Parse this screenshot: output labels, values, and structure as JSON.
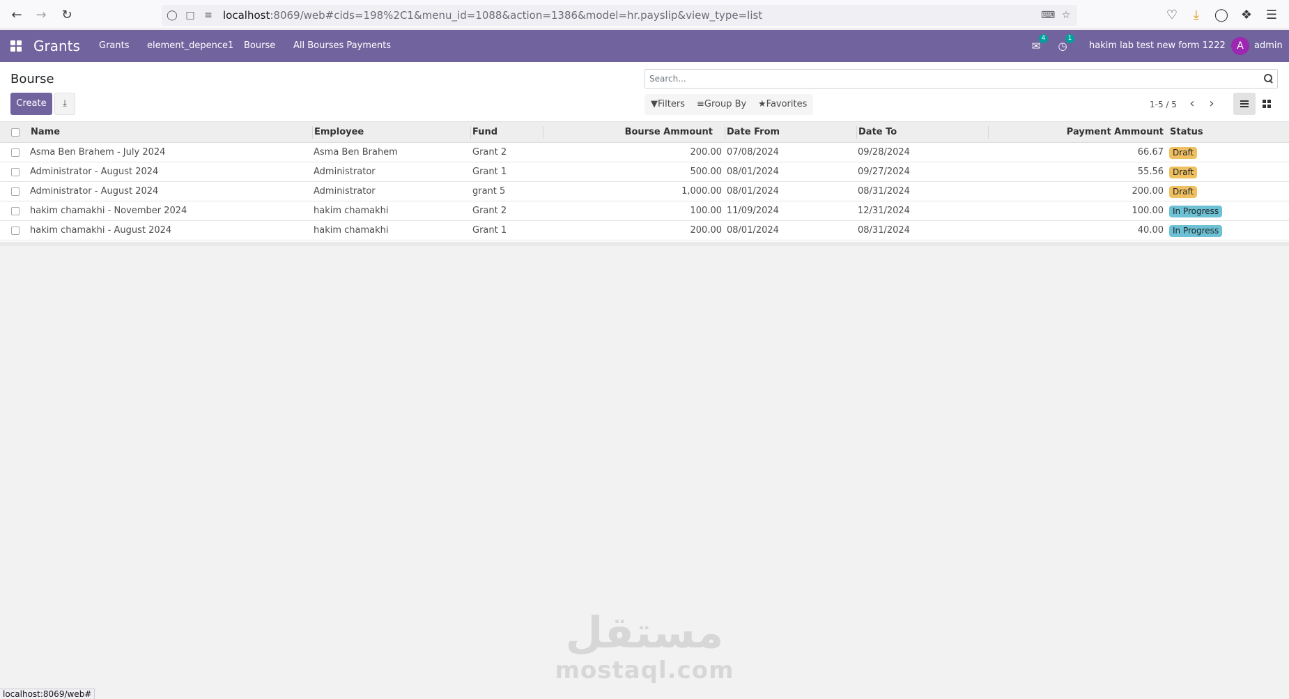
{
  "browser": {
    "url_host": "localhost",
    "url_rest": ":8069/web#cids=198%2C1&menu_id=1088&action=1386&model=hr.payslip&view_type=list",
    "status_url": "localhost:8069/web#"
  },
  "navbar": {
    "app_name": "Grants",
    "menu": [
      "Grants",
      "element_depence1",
      "Bourse",
      "All Bourses Payments"
    ],
    "messages_count": "4",
    "activities_count": "1",
    "company": "hakim lab test new form 1222",
    "avatar_letter": "A",
    "user": "admin"
  },
  "control_panel": {
    "title": "Bourse",
    "create_label": "Create",
    "search_placeholder": "Search...",
    "filters_label": "Filters",
    "group_by_label": "Group By",
    "favorites_label": "Favorites",
    "pager": "1-5 / 5"
  },
  "table": {
    "columns": {
      "name": "Name",
      "employee": "Employee",
      "fund": "Fund",
      "bourse_amount": "Bourse Ammount",
      "date_from": "Date From",
      "date_to": "Date To",
      "payment_amount": "Payment Ammount",
      "status": "Status"
    },
    "rows": [
      {
        "name": "Asma Ben Brahem - July 2024",
        "employee": "Asma Ben Brahem",
        "fund": "Grant 2",
        "bourse_amount": "200.00",
        "date_from": "07/08/2024",
        "date_to": "09/28/2024",
        "payment_amount": "66.67",
        "status": "Draft"
      },
      {
        "name": "Administrator - August 2024",
        "employee": "Administrator",
        "fund": "Grant 1",
        "bourse_amount": "500.00",
        "date_from": "08/01/2024",
        "date_to": "09/27/2024",
        "payment_amount": "55.56",
        "status": "Draft"
      },
      {
        "name": "Administrator - August 2024",
        "employee": "Administrator",
        "fund": "grant 5",
        "bourse_amount": "1,000.00",
        "date_from": "08/01/2024",
        "date_to": "08/31/2024",
        "payment_amount": "200.00",
        "status": "Draft"
      },
      {
        "name": "hakim chamakhi - November 2024",
        "employee": "hakim chamakhi",
        "fund": "Grant 2",
        "bourse_amount": "100.00",
        "date_from": "11/09/2024",
        "date_to": "12/31/2024",
        "payment_amount": "100.00",
        "status": "In Progress"
      },
      {
        "name": "hakim chamakhi - August 2024",
        "employee": "hakim chamakhi",
        "fund": "Grant 1",
        "bourse_amount": "200.00",
        "date_from": "08/01/2024",
        "date_to": "08/31/2024",
        "payment_amount": "40.00",
        "status": "In Progress"
      }
    ]
  },
  "watermark": {
    "arabic": "مستقل",
    "latin": "mostaql.com"
  },
  "colors": {
    "brand": "#71639e",
    "draft_badge": "#f0c060",
    "in_progress_badge": "#6cc1d4",
    "badge_dot": "#00a09d"
  }
}
